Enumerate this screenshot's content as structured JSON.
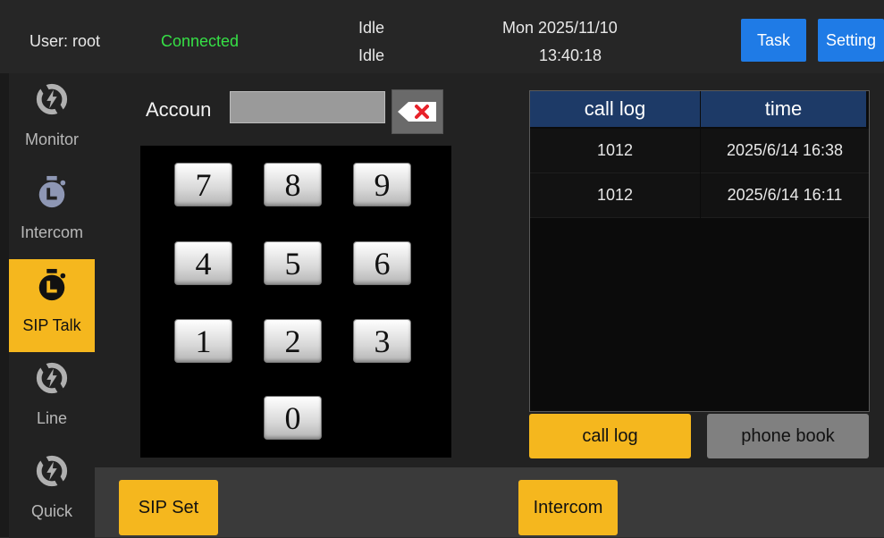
{
  "header": {
    "user_label": "User: root",
    "connection_status": "Connected",
    "status_line1": "Idle",
    "status_line2": "Idle",
    "date": "Mon 2025/11/10",
    "time": "13:40:18",
    "task_label": "Task",
    "setting_label": "Setting"
  },
  "sidebar": {
    "items": [
      {
        "label": "Monitor",
        "icon": "refresh-icon"
      },
      {
        "label": "Intercom",
        "icon": "stopwatch-icon"
      },
      {
        "label": "SIP Talk",
        "icon": "stopwatch-icon",
        "active": true
      },
      {
        "label": "Line",
        "icon": "refresh-icon"
      },
      {
        "label": "Quick",
        "icon": "refresh-icon"
      }
    ]
  },
  "dialer": {
    "account_label": "Accoun",
    "account_value": "",
    "keys": [
      "7",
      "8",
      "9",
      "4",
      "5",
      "6",
      "1",
      "2",
      "3",
      "0"
    ]
  },
  "call_log": {
    "columns": [
      "call log",
      "time"
    ],
    "rows": [
      {
        "number": "1012",
        "time": "2025/6/14 16:38"
      },
      {
        "number": "1012",
        "time": "2025/6/14 16:11"
      }
    ]
  },
  "tabs": {
    "call_log": "call log",
    "phone_book": "phone book"
  },
  "bottom": {
    "sip_set": "SIP Set",
    "intercom": "Intercom"
  },
  "colors": {
    "accent_yellow": "#f5b71e",
    "button_blue": "#1f7be6",
    "connected_green": "#36e046",
    "table_header": "#1d3a67",
    "tab_inactive": "#808080"
  }
}
